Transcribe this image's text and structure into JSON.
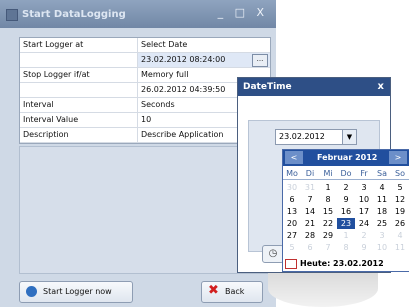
{
  "window": {
    "title": "Start DataLogging",
    "controls": "_ □ X"
  },
  "grid": [
    {
      "key": "Start Logger at",
      "value": "Select Date"
    },
    {
      "key": "",
      "value": "23.02.2012 08:24:00",
      "ellipsis": "..."
    },
    {
      "key": "Stop Logger if/at",
      "value": "Memory full"
    },
    {
      "key": "",
      "value": "26.02.2012 04:39:50"
    },
    {
      "key": "Interval",
      "value": "Seconds"
    },
    {
      "key": "Interval Value",
      "value": "10"
    },
    {
      "key": "Description",
      "value": "Describe Application"
    }
  ],
  "buttons": {
    "start": "Start Logger now",
    "back": "Back"
  },
  "popup": {
    "title": "DateTime",
    "close": "x",
    "date_value": "23.02.2012",
    "calendar": {
      "month": "Februar 2012",
      "prev": "<",
      "next": ">",
      "weekdays": [
        "Mo",
        "Di",
        "Mi",
        "Do",
        "Fr",
        "Sa",
        "So"
      ],
      "weeks": [
        [
          "30",
          "31",
          "1",
          "2",
          "3",
          "4",
          "5"
        ],
        [
          "6",
          "7",
          "8",
          "9",
          "10",
          "11",
          "12"
        ],
        [
          "13",
          "14",
          "15",
          "16",
          "17",
          "18",
          "19"
        ],
        [
          "20",
          "21",
          "22",
          "23",
          "24",
          "25",
          "26"
        ],
        [
          "27",
          "28",
          "29",
          "1",
          "2",
          "3",
          "4"
        ],
        [
          "5",
          "6",
          "7",
          "8",
          "9",
          "10",
          "11"
        ]
      ],
      "selected_day": "23",
      "today_label": "Heute: 23.02.2012"
    },
    "small_button_icon": "clock-icon"
  }
}
